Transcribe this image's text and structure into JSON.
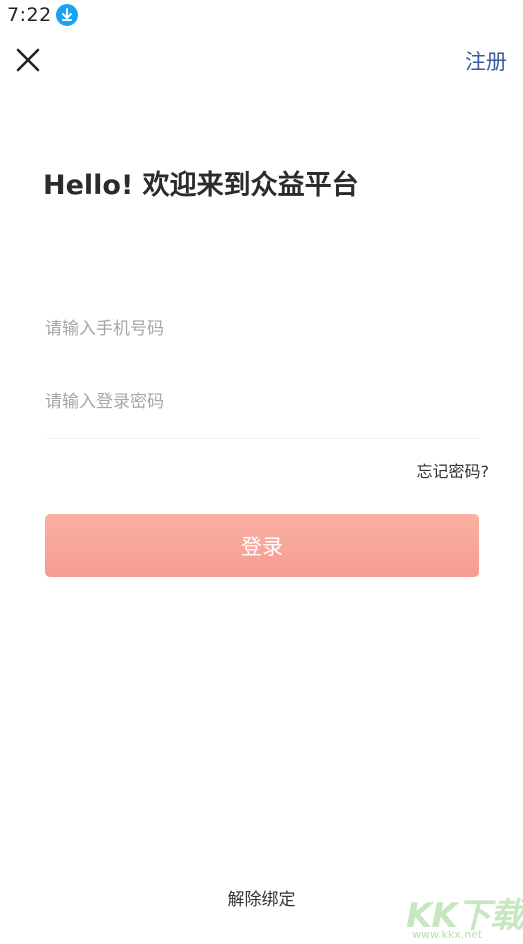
{
  "status_bar": {
    "time": "7:22",
    "download_icon": "download-arrow-icon"
  },
  "header": {
    "close_icon": "close-icon",
    "register_label": "注册"
  },
  "title": "Hello! 欢迎来到众益平台",
  "form": {
    "phone_placeholder": "请输入手机号码",
    "phone_value": "",
    "password_placeholder": "请输入登录密码",
    "password_value": "",
    "forgot_label": "忘记密码?",
    "login_label": "登录"
  },
  "footer": {
    "unbind_label": "解除绑定"
  },
  "watermark": {
    "logo_text": "KK下载",
    "url": "www.kkx.net"
  },
  "colors": {
    "accent_link": "#3a5b9e",
    "login_gradient_top": "#fbb1a2",
    "login_gradient_bottom": "#f59b93",
    "status_badge": "#1aa3f0"
  }
}
